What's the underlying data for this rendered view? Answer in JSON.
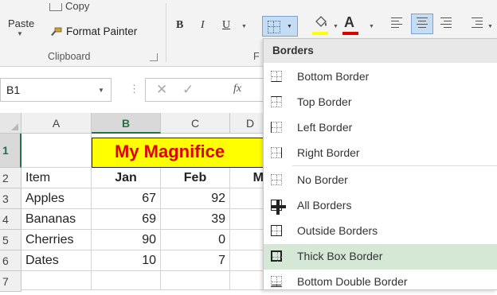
{
  "ribbon": {
    "paste_label": "Paste",
    "copy_label": "Copy",
    "format_painter_label": "Format Painter",
    "clipboard_group_label": "Clipboard",
    "font_group_label_partial": "F",
    "bold": "B",
    "italic": "I",
    "underline": "U",
    "font_color_glyph": "A",
    "fill_color": "#ffff00",
    "font_color": "#e00000",
    "selected_button_color": "#c5dcf5"
  },
  "formula_bar": {
    "name_box": "B1",
    "cancel_glyph": "✕",
    "enter_glyph": "✓",
    "fx_label": "fx"
  },
  "sheet": {
    "columns": [
      "A",
      "B",
      "C",
      "D"
    ],
    "rows": [
      "1",
      "2",
      "3",
      "4",
      "5",
      "6",
      "7"
    ],
    "title": "My Magnificent",
    "title_visible": "My Magnifice",
    "title_bg": "#ffff00",
    "title_color": "#e00000",
    "header": [
      "Item",
      "Jan",
      "Feb",
      "M"
    ],
    "data": [
      {
        "item": "Apples",
        "jan": "67",
        "feb": "92"
      },
      {
        "item": "Bananas",
        "jan": "69",
        "feb": "39"
      },
      {
        "item": "Cherries",
        "jan": "90",
        "feb": "0"
      },
      {
        "item": "Dates",
        "jan": "10",
        "feb": "7"
      }
    ]
  },
  "borders_menu": {
    "header": "Borders",
    "items": [
      {
        "label": "Bottom Border",
        "icon": "bottom-border-icon"
      },
      {
        "label": "Top Border",
        "icon": "top-border-icon"
      },
      {
        "label": "Left Border",
        "icon": "left-border-icon"
      },
      {
        "label": "Right Border",
        "icon": "right-border-icon"
      },
      {
        "label": "No Border",
        "icon": "no-border-icon"
      },
      {
        "label": "All Borders",
        "icon": "all-borders-icon"
      },
      {
        "label": "Outside Borders",
        "icon": "outside-borders-icon"
      },
      {
        "label": "Thick Box Border",
        "icon": "thick-box-border-icon",
        "highlighted": true
      },
      {
        "label": "Bottom Double Border",
        "icon": "bottom-double-border-icon"
      }
    ],
    "highlight_color": "#d5e8d6"
  }
}
